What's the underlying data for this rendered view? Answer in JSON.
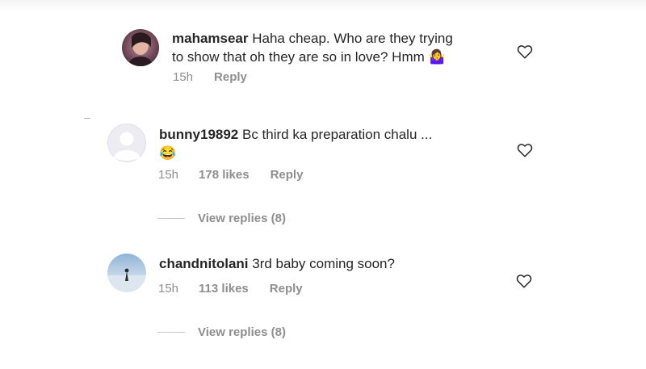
{
  "comments": [
    {
      "username": "mahamsear",
      "text_line1": "Haha cheap. Who are they trying",
      "text_line2": "to show that oh they are so in love? Hmm",
      "emoji": "🤷‍♀️",
      "time": "15h",
      "likes": "",
      "reply": "Reply",
      "avatar_icon": "profile-photo"
    },
    {
      "username": "bunny19892",
      "text_line1": "Bc third ka preparation chalu ...",
      "emoji": "😂",
      "time": "15h",
      "likes": "178 likes",
      "reply": "Reply",
      "view_replies": "View replies (8)",
      "avatar_icon": "default-avatar-icon"
    },
    {
      "username": "chandnitolani",
      "text_line1": "3rd baby coming soon?",
      "time": "15h",
      "likes": "113 likes",
      "reply": "Reply",
      "view_replies": "View replies (8)",
      "avatar_icon": "profile-photo"
    }
  ],
  "colors": {
    "text": "#262626",
    "muted": "#8e8e8e",
    "divider": "#c7c7c7"
  },
  "icons": {
    "like": "heart-outline-icon"
  }
}
